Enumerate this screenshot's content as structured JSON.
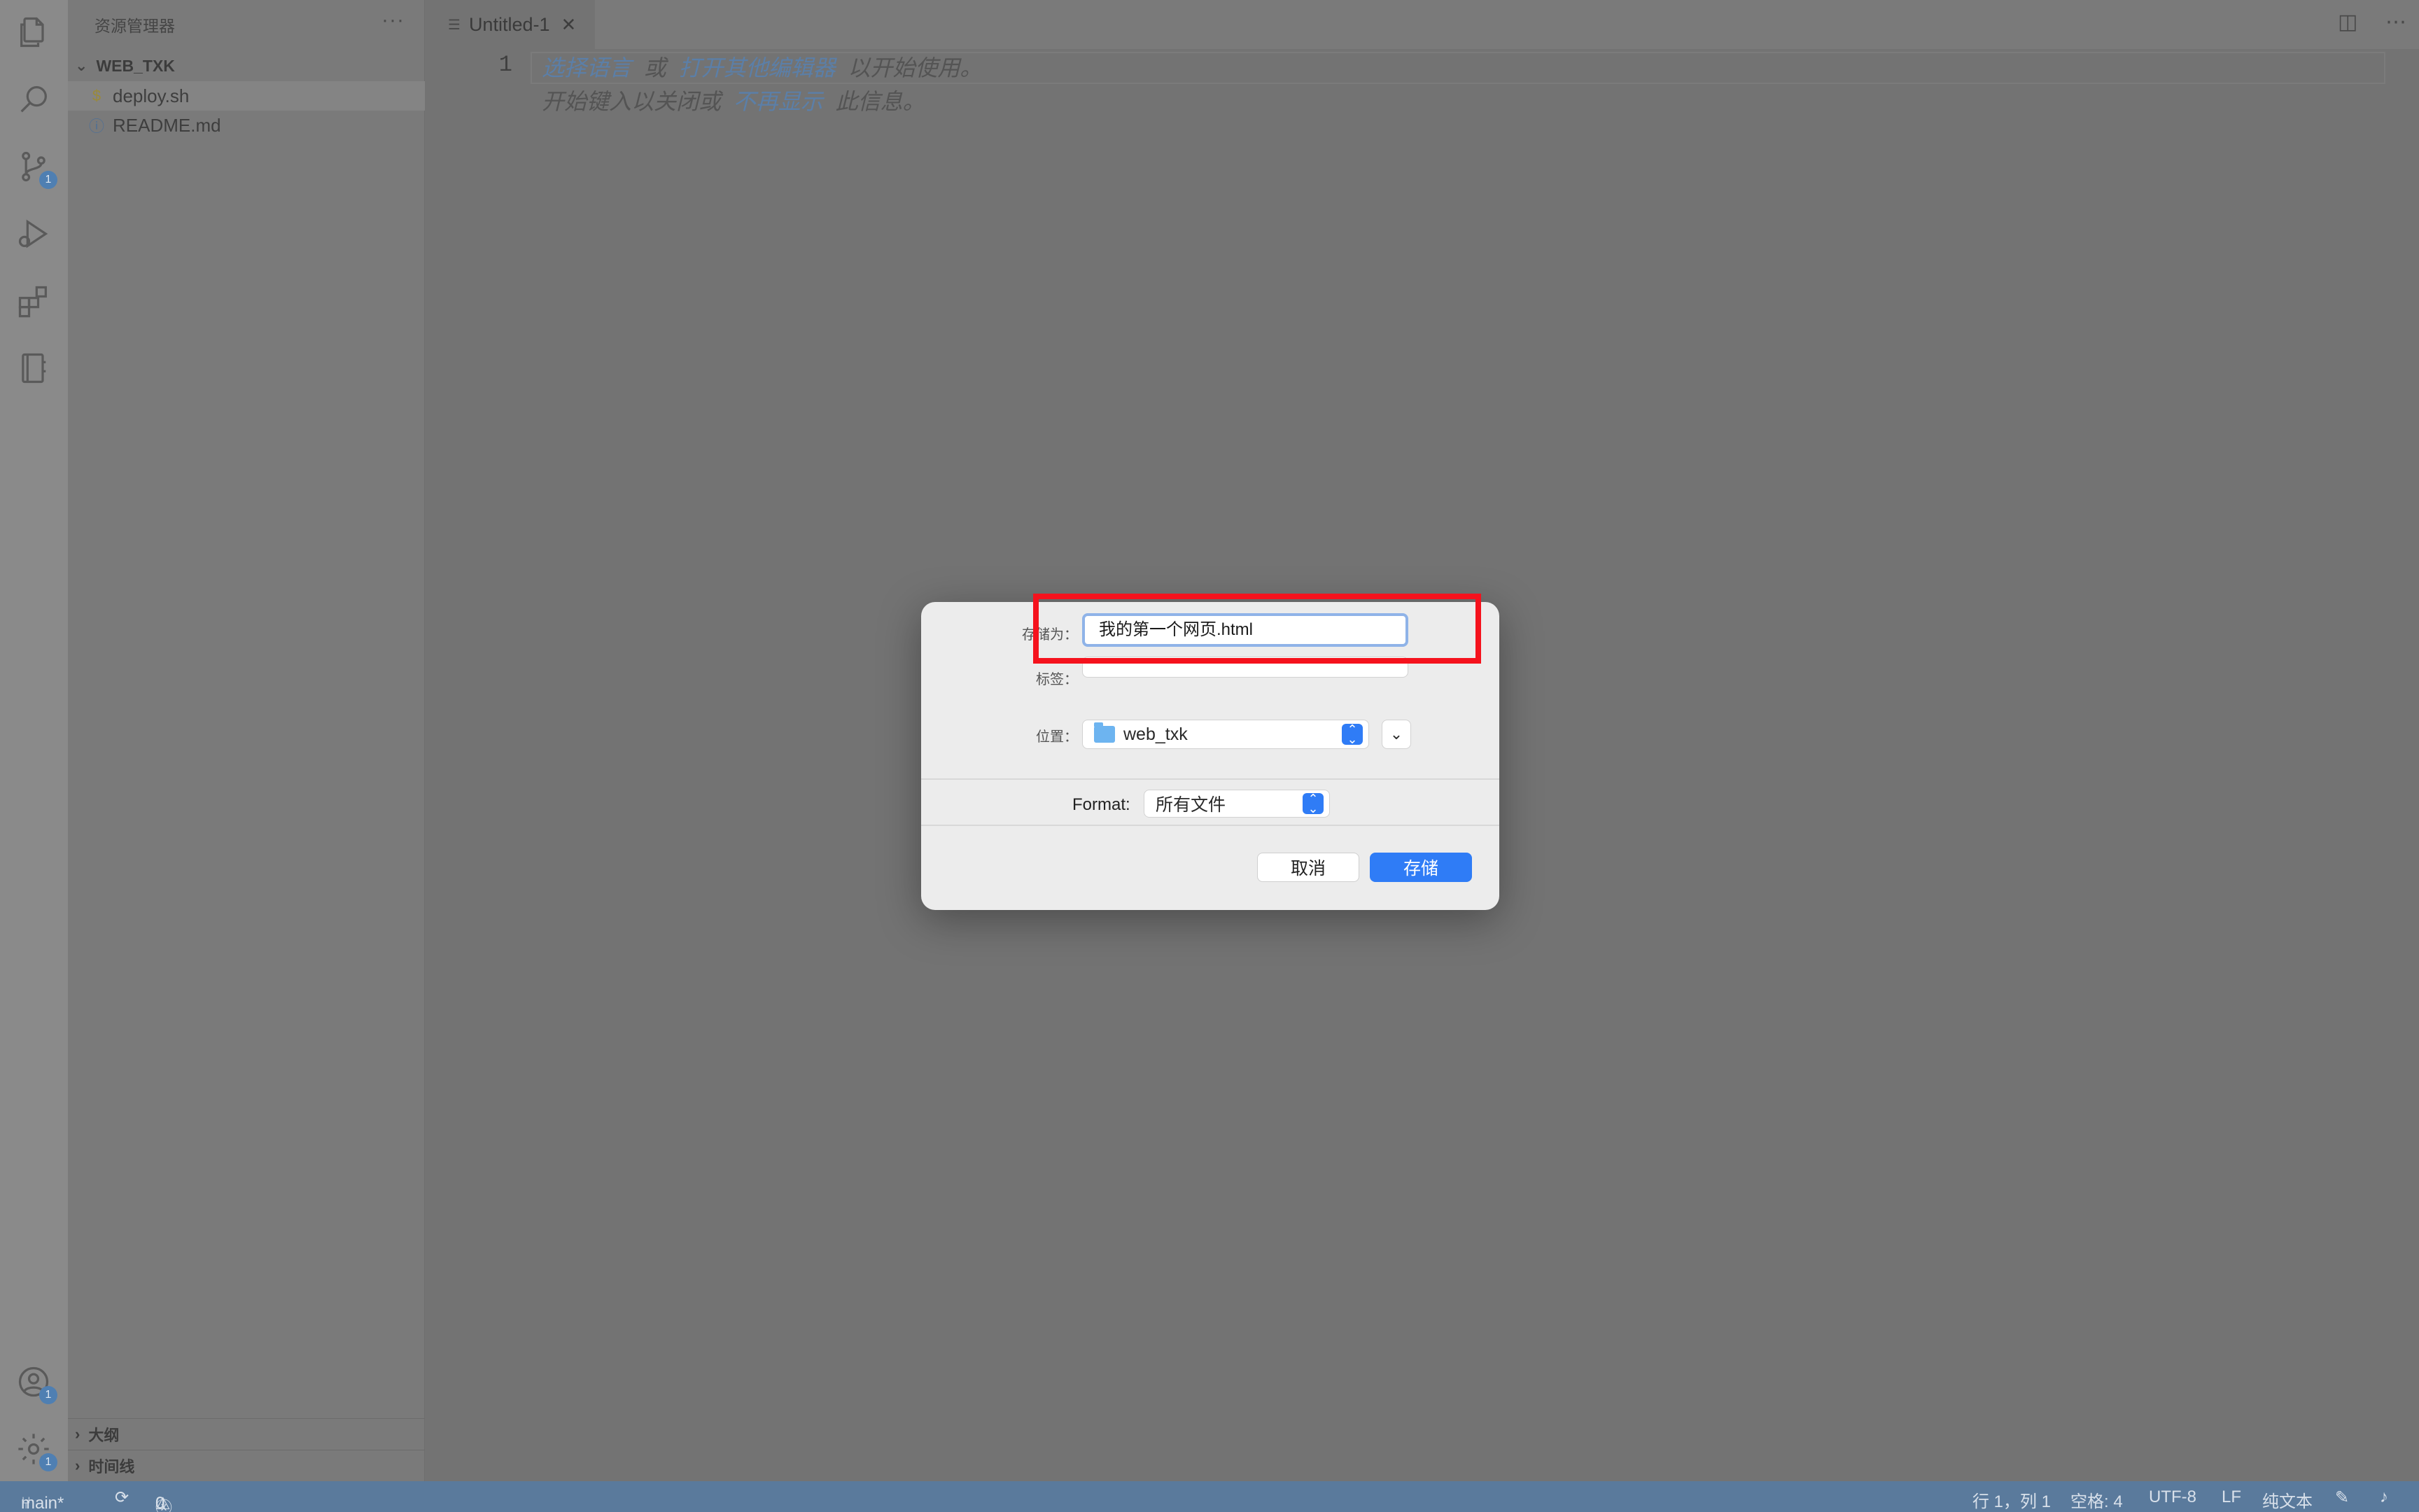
{
  "activitybar": {
    "scm_badge": "1",
    "accounts_badge": "1",
    "manage_badge": "1"
  },
  "sidebar": {
    "title": "资源管理器",
    "more": "···",
    "folder": "WEB_TXK",
    "files": [
      {
        "icon": "$",
        "name": "deploy.sh"
      },
      {
        "icon": "ⓘ",
        "name": "README.md"
      }
    ],
    "sections": [
      {
        "label": "大纲"
      },
      {
        "label": "时间线"
      }
    ]
  },
  "editor": {
    "tab_title": "Untitled-1",
    "line_number": "1",
    "hint1": {
      "link1": "选择语言",
      "or": "或",
      "link2": "打开其他编辑器",
      "tail": "以开始使用。"
    },
    "hint2": {
      "head": "开始键入以关闭或",
      "link": "不再显示",
      "tail": "此信息。"
    }
  },
  "dialog": {
    "save_as_label": "存储为：",
    "filename": "我的第一个网页.html",
    "tags_label": "标签：",
    "location_label": "位置：",
    "location_value": "web_txk",
    "format_label": "Format:",
    "format_value": "所有文件",
    "cancel_label": "取消",
    "save_label": "存储"
  },
  "statusbar": {
    "branch": "main*",
    "errors": "0",
    "warnings": "0",
    "position": "行 1，列 1",
    "spaces": "空格: 4",
    "encoding": "UTF-8",
    "eol": "LF",
    "language": "纯文本"
  }
}
